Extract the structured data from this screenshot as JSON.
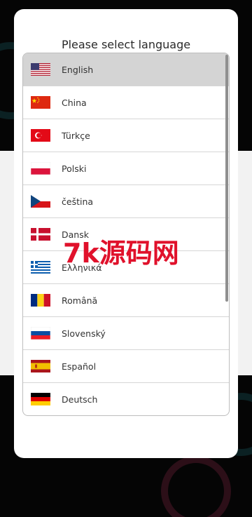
{
  "modal": {
    "title": "Please select language"
  },
  "languages": [
    {
      "label": "English",
      "flag": "us-flag-icon",
      "selected": true
    },
    {
      "label": "China",
      "flag": "china-flag-icon",
      "selected": false
    },
    {
      "label": "Türkçe",
      "flag": "turkey-flag-icon",
      "selected": false
    },
    {
      "label": "Polski",
      "flag": "poland-flag-icon",
      "selected": false
    },
    {
      "label": "čeština",
      "flag": "czech-flag-icon",
      "selected": false
    },
    {
      "label": "Dansk",
      "flag": "denmark-flag-icon",
      "selected": false
    },
    {
      "label": "Ελληνικά",
      "flag": "greece-flag-icon",
      "selected": false
    },
    {
      "label": "Română",
      "flag": "romania-flag-icon",
      "selected": false
    },
    {
      "label": "Slovenský",
      "flag": "slovakia-flag-icon",
      "selected": false
    },
    {
      "label": "Español",
      "flag": "spain-flag-icon",
      "selected": false
    },
    {
      "label": "Deutsch",
      "flag": "germany-flag-icon",
      "selected": false
    }
  ],
  "watermark": {
    "text": "7k源码网"
  },
  "colors": {
    "selected_row": "#d4d4d4",
    "watermark": "#e0112b",
    "backdrop": "#000000"
  }
}
